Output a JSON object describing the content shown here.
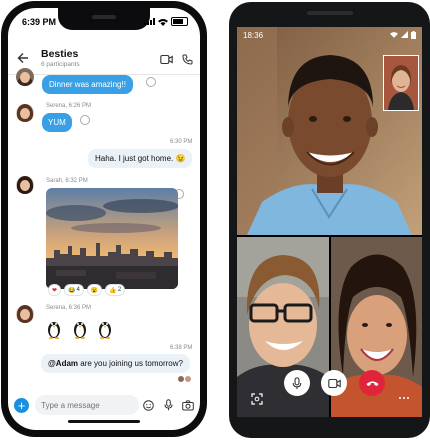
{
  "iphone": {
    "status_time": "6:39 PM",
    "chat": {
      "title": "Besties",
      "participants": "6 participants"
    },
    "messages": {
      "first_bubble": "Dinner was amazing!!",
      "serena_meta_1": "Serena, 6:26 PM",
      "serena_bubble": "YUM",
      "own_meta_1": "6:30 PM",
      "own_bubble_1": "Haha. I just got home. 😉",
      "sarah_meta": "Sarah, 6:32 PM",
      "reactions": [
        {
          "emoji": "❤",
          "count": ""
        },
        {
          "emoji": "😂",
          "count": "4"
        },
        {
          "emoji": "😮",
          "count": ""
        },
        {
          "emoji": "👍",
          "count": "2"
        }
      ],
      "serena_meta_2": "Serena, 6:36 PM",
      "own_meta_2": "6:38 PM",
      "own_mention": "@Adam",
      "own_bubble_2": " are you joining us tomorrow?"
    },
    "composer": {
      "placeholder": "Type a message"
    }
  },
  "android": {
    "status_time": "18:36"
  },
  "colors": {
    "accent_blue": "#3aa0e6",
    "end_call_red": "#e0253a"
  },
  "icons": [
    "back-arrow-icon",
    "video-call-icon",
    "phone-call-icon",
    "emoji-icon",
    "microphone-icon",
    "camera-icon",
    "plus-icon",
    "end-call-icon",
    "screen-share-icon",
    "more-icon"
  ]
}
